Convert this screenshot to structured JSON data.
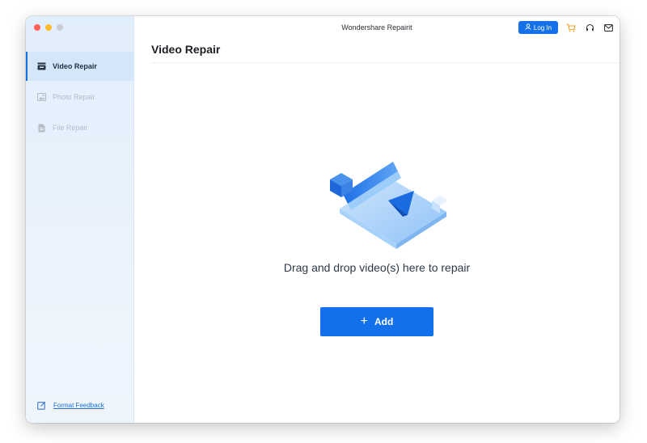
{
  "app": {
    "title": "Wondershare Repairit"
  },
  "header": {
    "login_label": "Log In"
  },
  "sidebar": {
    "items": [
      {
        "label": "Video Repair",
        "icon": "video-repair-icon",
        "state": "active"
      },
      {
        "label": "Photo Repair",
        "icon": "photo-repair-icon",
        "state": "disabled"
      },
      {
        "label": "File Repair",
        "icon": "file-repair-icon",
        "state": "disabled"
      }
    ],
    "feedback_label": "Format Feedback"
  },
  "main": {
    "title": "Video Repair",
    "drop_text": "Drag and drop video(s) here to repair",
    "add_label": "Add"
  },
  "colors": {
    "accent": "#1471ea",
    "sidebar_bg": "#e6f1fb",
    "active_item_bg": "#d4e6f8",
    "disabled_text": "#b4bcc6"
  }
}
